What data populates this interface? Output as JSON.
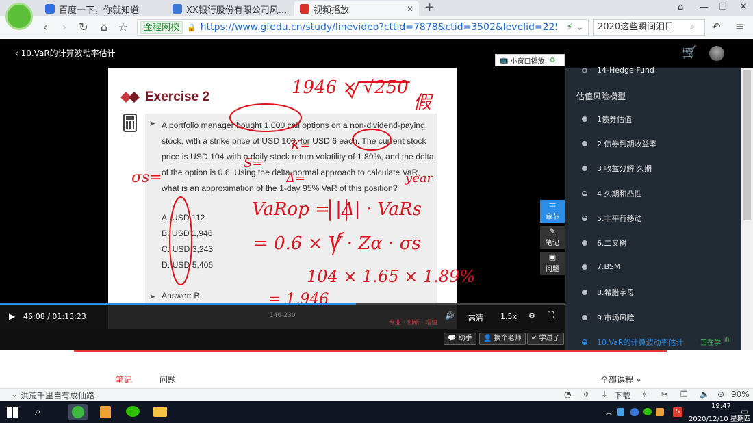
{
  "browser": {
    "tabs": [
      {
        "title": "百度一下，你就知道"
      },
      {
        "title": "XX银行股份有限公司风..."
      },
      {
        "title": "视频播放"
      }
    ],
    "new_tab": "+",
    "url_site_chip": "金程网校",
    "url": "https://www.gfedu.cn/study/linevideo?cttid=7878&ctid=3502&levelid=225481&teac",
    "search_text": "2020这些瞬间泪目"
  },
  "page": {
    "back_title": "10.VaR的计算波动率估计",
    "mini_window": "小窗口播放"
  },
  "slide": {
    "title": "Exercise 2",
    "question": "A portfolio manager bought 1,000 call options on a non-dividend-paying stock, with a strike price of USD 100, for USD 6 each. The current stock price is USD 104 with a daily stock return volatility of 1.89%, and the delta of the option is 0.6. Using the delta-normal approach to calculate VaR, what is an approximation of the 1-day 95% VaR of this position?",
    "options": [
      "A.  USD 112",
      "B.  USD 1,946",
      "C.  USD 3,243",
      "D.  USD 5,406"
    ],
    "answer": "Answer: B",
    "footer": "146-230",
    "brand": "专业 · 创新 · 增值",
    "handwriting": {
      "top": "1946 × √250",
      "top_suffix": "假",
      "formula1": "VaRop = |Δ| · VaRs",
      "formula2": "= 0.6 × V · Zα · σs",
      "formula3": "104 × 1.65 × 1.89%",
      "formula4": "= 1,946",
      "k": "K=",
      "s": "S=",
      "delta": "Δ=",
      "sigma": "σs=",
      "year": "year"
    }
  },
  "player": {
    "time": "46:08 / 01:13:23",
    "quality": "高清",
    "speed": "1.5x",
    "progress": 0.63
  },
  "side_buttons": [
    {
      "label": "章节"
    },
    {
      "label": "笔记"
    },
    {
      "label": "问题"
    }
  ],
  "below_buttons": {
    "assistant": "助手",
    "change_teacher": "换个老师",
    "learned": "学过了"
  },
  "sidebar": {
    "prev_item": "14-Hedge Fund",
    "section_title": "估值风险模型",
    "items": [
      {
        "label": "1债券估值"
      },
      {
        "label": "2 债券到期收益率"
      },
      {
        "label": "3 收益分解 久期"
      },
      {
        "label": "4 久期和凸性"
      },
      {
        "label": "5.非平行移动"
      },
      {
        "label": "6.二叉树"
      },
      {
        "label": "7.BSM"
      },
      {
        "label": "8.希腊字母"
      },
      {
        "label": "9.市场风险"
      },
      {
        "label": "10.VaR的计算波动率估计"
      }
    ],
    "current_status": "正在学"
  },
  "under": {
    "tab_notes": "笔记",
    "tab_questions": "问题",
    "all_courses": "全部课程"
  },
  "statusbar": {
    "left_text": "洪荒千里自有成仙路",
    "download": "下载",
    "zoom": "90%"
  },
  "taskbar": {
    "time": "19:47",
    "date": "2020/12/10 星期四"
  },
  "colors": {
    "accent_blue": "#2b8de6",
    "ink_red": "#e0121c",
    "slide_title": "#7b1a23",
    "sidebar_bg": "#222a33"
  }
}
